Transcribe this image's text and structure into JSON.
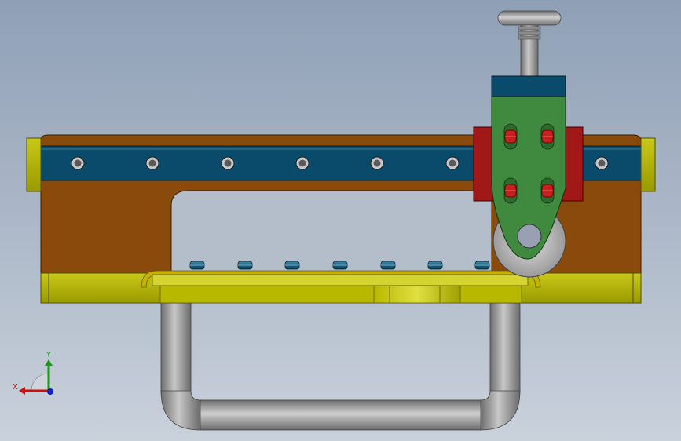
{
  "viewport": {
    "colors": {
      "background_top": "#8fa0b6",
      "background_bottom": "#c9d1db",
      "frame_brown": "#8a4a0c",
      "rail_blue": "#0a4a6a",
      "base_yellow": "#a8a800",
      "carriage_green": "#3f8a3f",
      "carriage_red": "#a01818",
      "bolt_red": "#c42020",
      "handle_steel": "#8a8a8a",
      "knob_steel": "#9a9a9a"
    },
    "model_parts": [
      "frame-body",
      "linear-rail",
      "base-plate",
      "end-stop-left",
      "end-stop-right",
      "carriage-plate",
      "carriage-block-left",
      "carriage-block-right",
      "adjustment-knob",
      "cutter-wheel",
      "u-handle",
      "handle-bracket"
    ],
    "rail_hole_count": 7,
    "base_bolt_count": 7,
    "carriage_slot_count": 4
  },
  "triad": {
    "x_label": "X",
    "y_label": "Y",
    "x_color": "#cc1010",
    "y_color": "#10a010",
    "z_color": "#1020cc"
  }
}
